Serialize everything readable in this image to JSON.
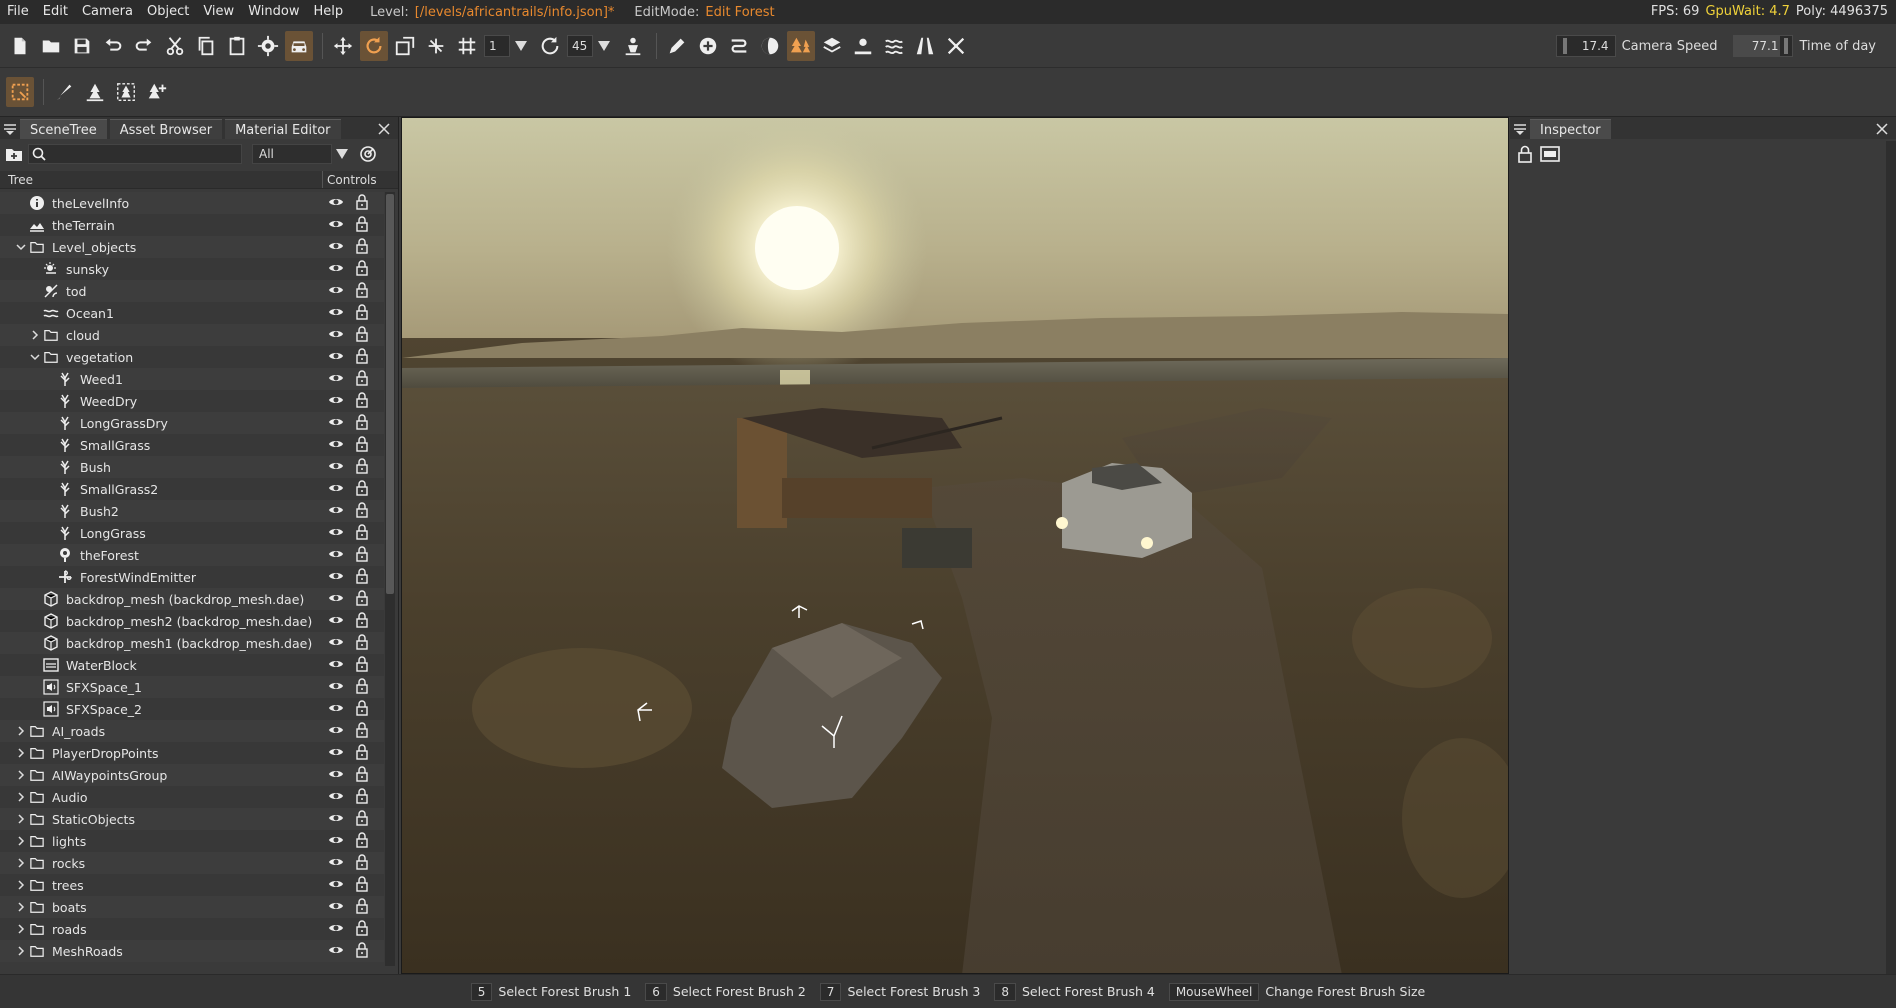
{
  "menubar": {
    "items": [
      "File",
      "Edit",
      "Camera",
      "Object",
      "View",
      "Window",
      "Help"
    ],
    "level_label": "Level:",
    "level_path": "[/levels/africantrails/info.json]*",
    "editmode_label": "EditMode:",
    "editmode_value": "Edit Forest",
    "fps": "FPS: 69",
    "gpuwait": "GpuWait: 4.7",
    "poly": "Poly: 4496375"
  },
  "toolbar": {
    "snap_value": "1",
    "rotate_value": "45",
    "camera_speed_value": "17.4",
    "camera_speed_label": "Camera Speed",
    "time_of_day_value": "77.1",
    "time_of_day_label": "Time of day"
  },
  "leftpanel": {
    "tabs": [
      "SceneTree",
      "Asset Browser",
      "Material Editor"
    ],
    "filter_value": "All",
    "col_tree": "Tree",
    "col_controls": "Controls",
    "rows": [
      {
        "name": "theLevelInfo",
        "icon": "info-icon",
        "indent": 0,
        "chev": ""
      },
      {
        "name": "theTerrain",
        "icon": "terrain-icon",
        "indent": 0,
        "chev": ""
      },
      {
        "name": "Level_objects",
        "icon": "folder-icon",
        "indent": 0,
        "chev": "down"
      },
      {
        "name": "sunsky",
        "icon": "sunsky-icon",
        "indent": 1,
        "chev": ""
      },
      {
        "name": "tod",
        "icon": "tod-icon",
        "indent": 1,
        "chev": ""
      },
      {
        "name": "Ocean1",
        "icon": "ocean-icon",
        "indent": 1,
        "chev": ""
      },
      {
        "name": "cloud",
        "icon": "folder-icon",
        "indent": 1,
        "chev": "right"
      },
      {
        "name": "vegetation",
        "icon": "folder-icon",
        "indent": 1,
        "chev": "down"
      },
      {
        "name": "Weed1",
        "icon": "plant-icon",
        "indent": 2,
        "chev": ""
      },
      {
        "name": "WeedDry",
        "icon": "plant-icon",
        "indent": 2,
        "chev": ""
      },
      {
        "name": "LongGrassDry",
        "icon": "plant-icon",
        "indent": 2,
        "chev": ""
      },
      {
        "name": "SmallGrass",
        "icon": "plant-icon",
        "indent": 2,
        "chev": ""
      },
      {
        "name": "Bush",
        "icon": "plant-icon",
        "indent": 2,
        "chev": ""
      },
      {
        "name": "SmallGrass2",
        "icon": "plant-icon",
        "indent": 2,
        "chev": ""
      },
      {
        "name": "Bush2",
        "icon": "plant-icon",
        "indent": 2,
        "chev": ""
      },
      {
        "name": "LongGrass",
        "icon": "plant-icon",
        "indent": 2,
        "chev": ""
      },
      {
        "name": "theForest",
        "icon": "forest-icon",
        "indent": 2,
        "chev": ""
      },
      {
        "name": "ForestWindEmitter",
        "icon": "wind-icon",
        "indent": 2,
        "chev": ""
      },
      {
        "name": "backdrop_mesh (backdrop_mesh.dae)",
        "icon": "mesh-icon",
        "indent": 1,
        "chev": ""
      },
      {
        "name": "backdrop_mesh2 (backdrop_mesh.dae)",
        "icon": "mesh-icon",
        "indent": 1,
        "chev": ""
      },
      {
        "name": "backdrop_mesh1 (backdrop_mesh.dae)",
        "icon": "mesh-icon",
        "indent": 1,
        "chev": ""
      },
      {
        "name": "WaterBlock",
        "icon": "water-icon",
        "indent": 1,
        "chev": ""
      },
      {
        "name": "SFXSpace_1",
        "icon": "sound-icon",
        "indent": 1,
        "chev": ""
      },
      {
        "name": "SFXSpace_2",
        "icon": "sound-icon",
        "indent": 1,
        "chev": ""
      },
      {
        "name": "AI_roads",
        "icon": "folder-icon",
        "indent": 0,
        "chev": "right"
      },
      {
        "name": "PlayerDropPoints",
        "icon": "folder-icon",
        "indent": 0,
        "chev": "right"
      },
      {
        "name": "AIWaypointsGroup",
        "icon": "folder-icon",
        "indent": 0,
        "chev": "right"
      },
      {
        "name": "Audio",
        "icon": "folder-icon",
        "indent": 0,
        "chev": "right"
      },
      {
        "name": "StaticObjects",
        "icon": "folder-icon",
        "indent": 0,
        "chev": "right"
      },
      {
        "name": "lights",
        "icon": "folder-icon",
        "indent": 0,
        "chev": "right"
      },
      {
        "name": "rocks",
        "icon": "folder-icon",
        "indent": 0,
        "chev": "right"
      },
      {
        "name": "trees",
        "icon": "folder-icon",
        "indent": 0,
        "chev": "right"
      },
      {
        "name": "boats",
        "icon": "folder-icon",
        "indent": 0,
        "chev": "right"
      },
      {
        "name": "roads",
        "icon": "folder-icon",
        "indent": 0,
        "chev": "right"
      },
      {
        "name": "MeshRoads",
        "icon": "folder-icon",
        "indent": 0,
        "chev": "right"
      }
    ]
  },
  "inspector": {
    "tab": "Inspector"
  },
  "statusbar": {
    "hints": [
      {
        "key": "5",
        "text": "Select Forest Brush 1"
      },
      {
        "key": "6",
        "text": "Select Forest Brush 2"
      },
      {
        "key": "7",
        "text": "Select Forest Brush 3"
      },
      {
        "key": "8",
        "text": "Select Forest Brush 4"
      },
      {
        "key": "MouseWheel",
        "text": "Change Forest Brush Size"
      }
    ]
  },
  "colors": {
    "accent_orange": "#e8892e",
    "gpu_yellow": "#f0d23a",
    "active_tool_bg": "#6a5236"
  }
}
